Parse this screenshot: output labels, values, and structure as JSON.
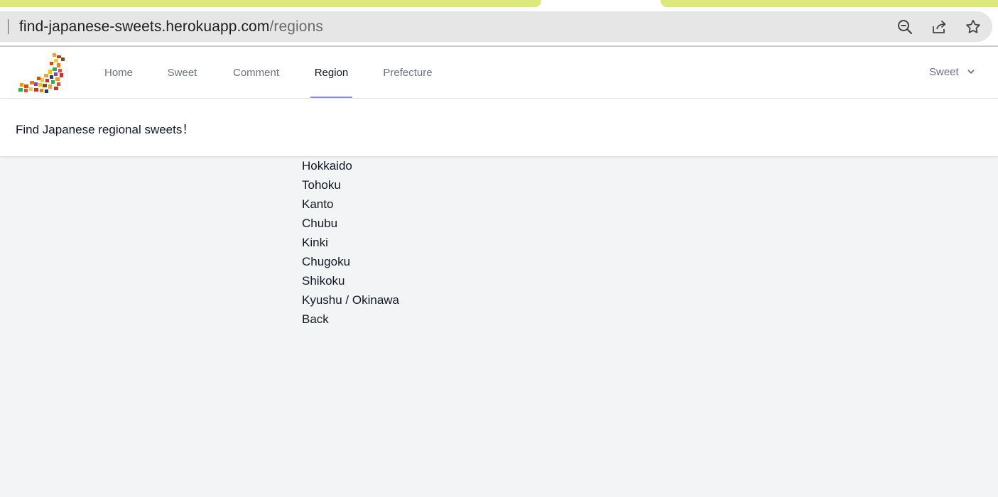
{
  "browser": {
    "url_host": "find-japanese-sweets.herokuapp.com",
    "url_path": "/regions",
    "icons": [
      "zoom-out-icon",
      "share-icon",
      "star-icon"
    ]
  },
  "nav": {
    "logo_icon": "japan-sweets-map-logo-icon",
    "links": [
      {
        "label": "Home"
      },
      {
        "label": "Sweet"
      },
      {
        "label": "Comment"
      },
      {
        "label": "Region"
      },
      {
        "label": "Prefecture"
      }
    ],
    "active_link": "Region",
    "user_menu_label": "Sweet",
    "user_menu_icon": "chevron-down-icon",
    "accent_color": "#818cf8"
  },
  "header": {
    "title": "Find Japanese regional sweets！"
  },
  "regions": [
    {
      "label": "Hokkaido"
    },
    {
      "label": "Tohoku"
    },
    {
      "label": "Kanto"
    },
    {
      "label": "Chubu"
    },
    {
      "label": "Kinki"
    },
    {
      "label": "Chugoku"
    },
    {
      "label": "Shikoku"
    },
    {
      "label": "Kyushu / Okinawa"
    }
  ],
  "back_label": "Back"
}
